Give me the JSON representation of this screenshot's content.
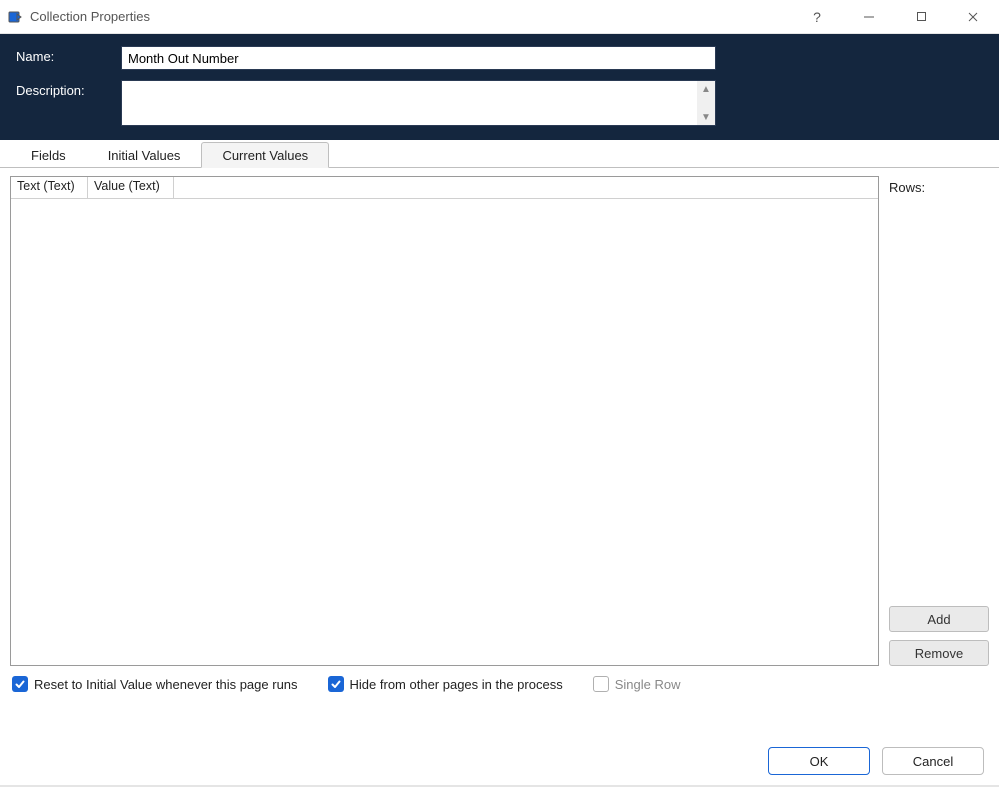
{
  "window": {
    "title": "Collection Properties"
  },
  "header": {
    "name_label": "Name:",
    "name_value": "Month Out Number",
    "description_label": "Description:",
    "description_value": ""
  },
  "tabs": [
    {
      "label": "Fields",
      "active": false
    },
    {
      "label": "Initial Values",
      "active": false
    },
    {
      "label": "Current Values",
      "active": true
    }
  ],
  "grid": {
    "columns": [
      "Text (Text)",
      "Value (Text)"
    ],
    "rows": []
  },
  "side": {
    "rows_label": "Rows:",
    "add_label": "Add",
    "remove_label": "Remove"
  },
  "checks": {
    "reset": {
      "label": "Reset to Initial Value whenever this page runs",
      "checked": true,
      "enabled": true
    },
    "hide": {
      "label": "Hide from other pages in the process",
      "checked": true,
      "enabled": true
    },
    "single": {
      "label": "Single Row",
      "checked": false,
      "enabled": false
    }
  },
  "footer": {
    "ok_label": "OK",
    "cancel_label": "Cancel"
  }
}
